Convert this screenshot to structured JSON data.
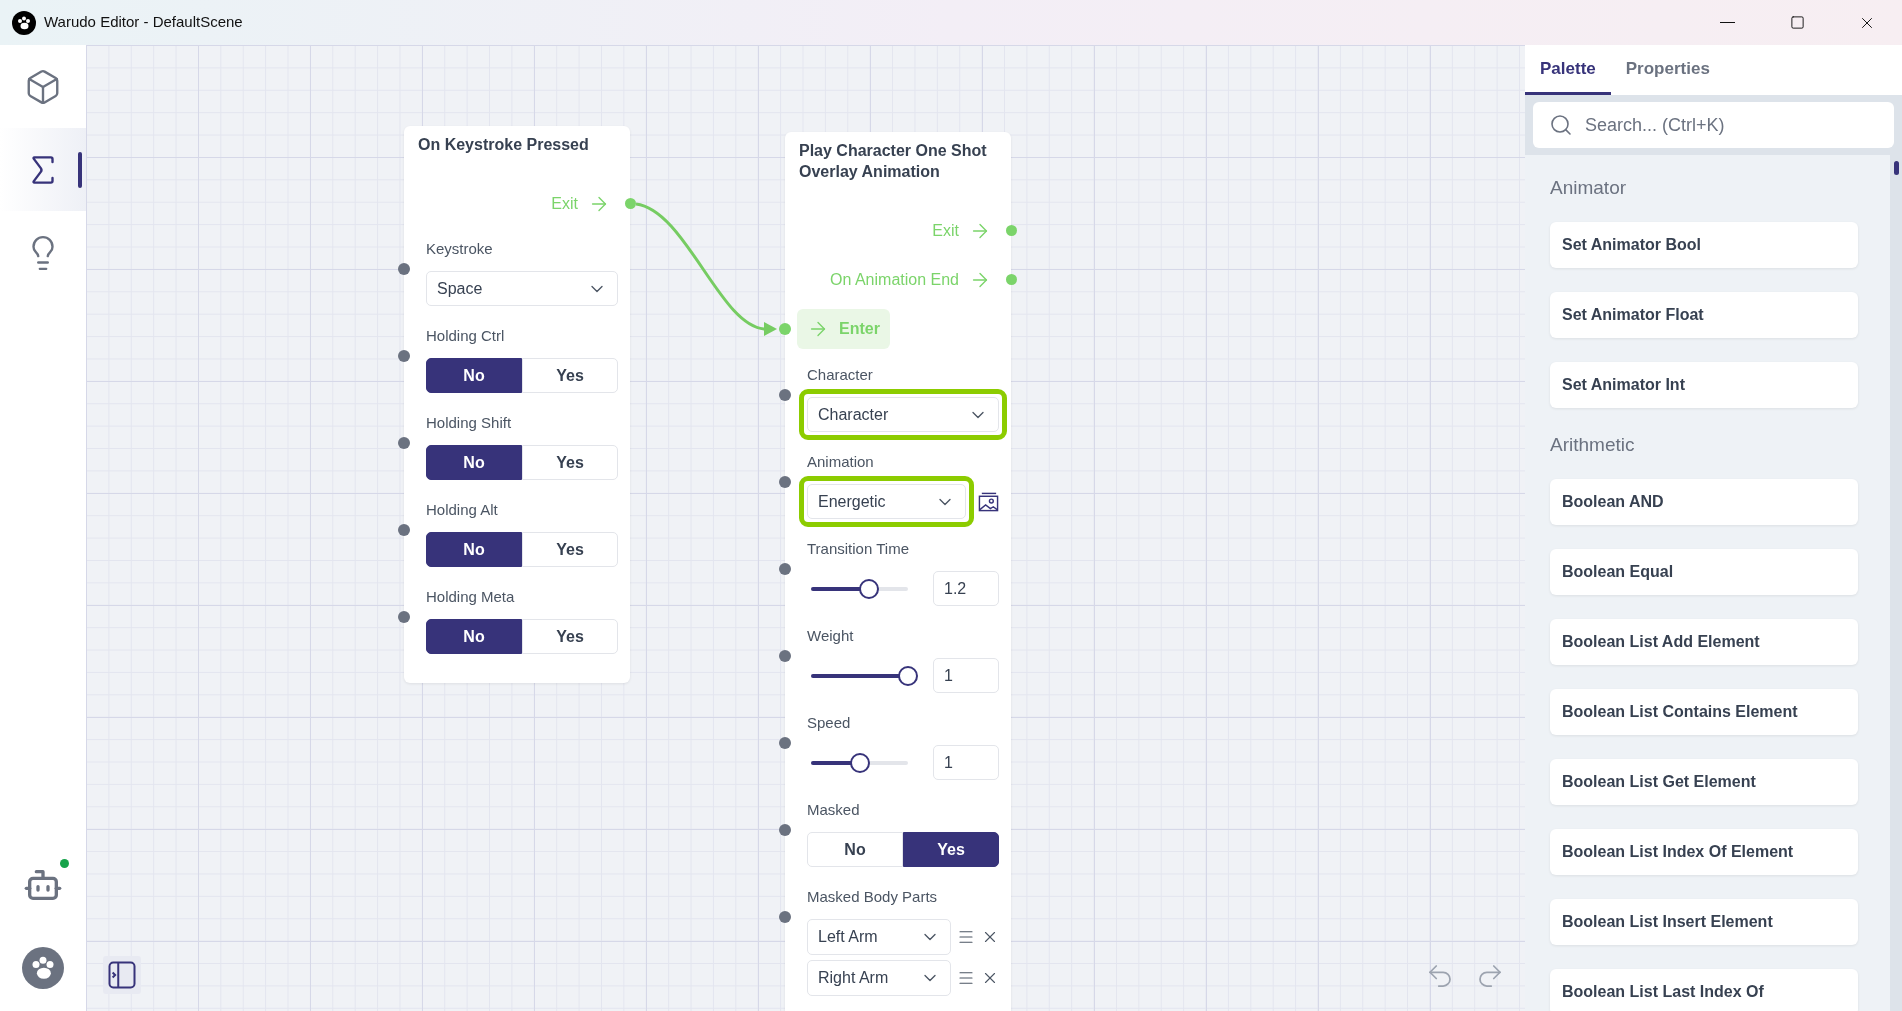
{
  "window": {
    "title": "Warudo Editor - DefaultScene"
  },
  "sidebar": {
    "items": [
      {
        "selected": false
      },
      {
        "selected": true
      },
      {
        "selected": false
      }
    ],
    "online": true
  },
  "nodes": [
    {
      "title": "On Keystroke Pressed",
      "outputs": [
        {
          "label": "Exit"
        }
      ],
      "fields": [
        {
          "kind": "dropdown",
          "label": "Keystroke",
          "value": "Space"
        },
        {
          "kind": "toggle",
          "label": "Holding Ctrl",
          "options": [
            {
              "label": "No",
              "selected": true
            },
            {
              "label": "Yes",
              "selected": false
            }
          ]
        },
        {
          "kind": "toggle",
          "label": "Holding Shift",
          "options": [
            {
              "label": "No",
              "selected": true
            },
            {
              "label": "Yes",
              "selected": false
            }
          ]
        },
        {
          "kind": "toggle",
          "label": "Holding Alt",
          "options": [
            {
              "label": "No",
              "selected": true
            },
            {
              "label": "Yes",
              "selected": false
            }
          ]
        },
        {
          "kind": "toggle",
          "label": "Holding Meta",
          "options": [
            {
              "label": "No",
              "selected": true
            },
            {
              "label": "Yes",
              "selected": false
            }
          ]
        }
      ]
    },
    {
      "title": "Play Character One Shot Overlay Animation",
      "outputs": [
        {
          "label": "Exit"
        },
        {
          "label": "On Animation End"
        }
      ],
      "enter": {
        "label": "Enter"
      },
      "fields": [
        {
          "kind": "dropdown",
          "label": "Character",
          "value": "Character",
          "highlighted": true
        },
        {
          "kind": "dropdown",
          "label": "Animation",
          "value": "Energetic",
          "highlighted": true,
          "preview": true
        },
        {
          "kind": "slider",
          "label": "Transition Time",
          "level": 0.6,
          "value": "1.2"
        },
        {
          "kind": "slider",
          "label": "Weight",
          "level": 1,
          "value": "1"
        },
        {
          "kind": "slider",
          "label": "Speed",
          "level": 0.5,
          "value": "1"
        },
        {
          "kind": "toggle",
          "label": "Masked",
          "options": [
            {
              "label": "No",
              "selected": false
            },
            {
              "label": "Yes",
              "selected": true
            }
          ]
        },
        {
          "kind": "list",
          "label": "Masked Body Parts",
          "items": [
            {
              "value": "Left Arm"
            },
            {
              "value": "Right Arm"
            }
          ]
        }
      ]
    }
  ],
  "panel": {
    "tabs": [
      {
        "label": "Palette",
        "selected": true
      },
      {
        "label": "Properties",
        "selected": false
      }
    ],
    "search": {
      "placeholder": "Search... (Ctrl+K)"
    },
    "sections": [
      {
        "title": "Animator",
        "items": [
          "Set Animator Bool",
          "Set Animator Float",
          "Set Animator Int"
        ]
      },
      {
        "title": "Arithmetic",
        "items": [
          "Boolean AND",
          "Boolean Equal",
          "Boolean List Add Element",
          "Boolean List Contains Element",
          "Boolean List Get Element",
          "Boolean List Index Of Element",
          "Boolean List Insert Element",
          "Boolean List Last Index Of"
        ]
      }
    ]
  }
}
